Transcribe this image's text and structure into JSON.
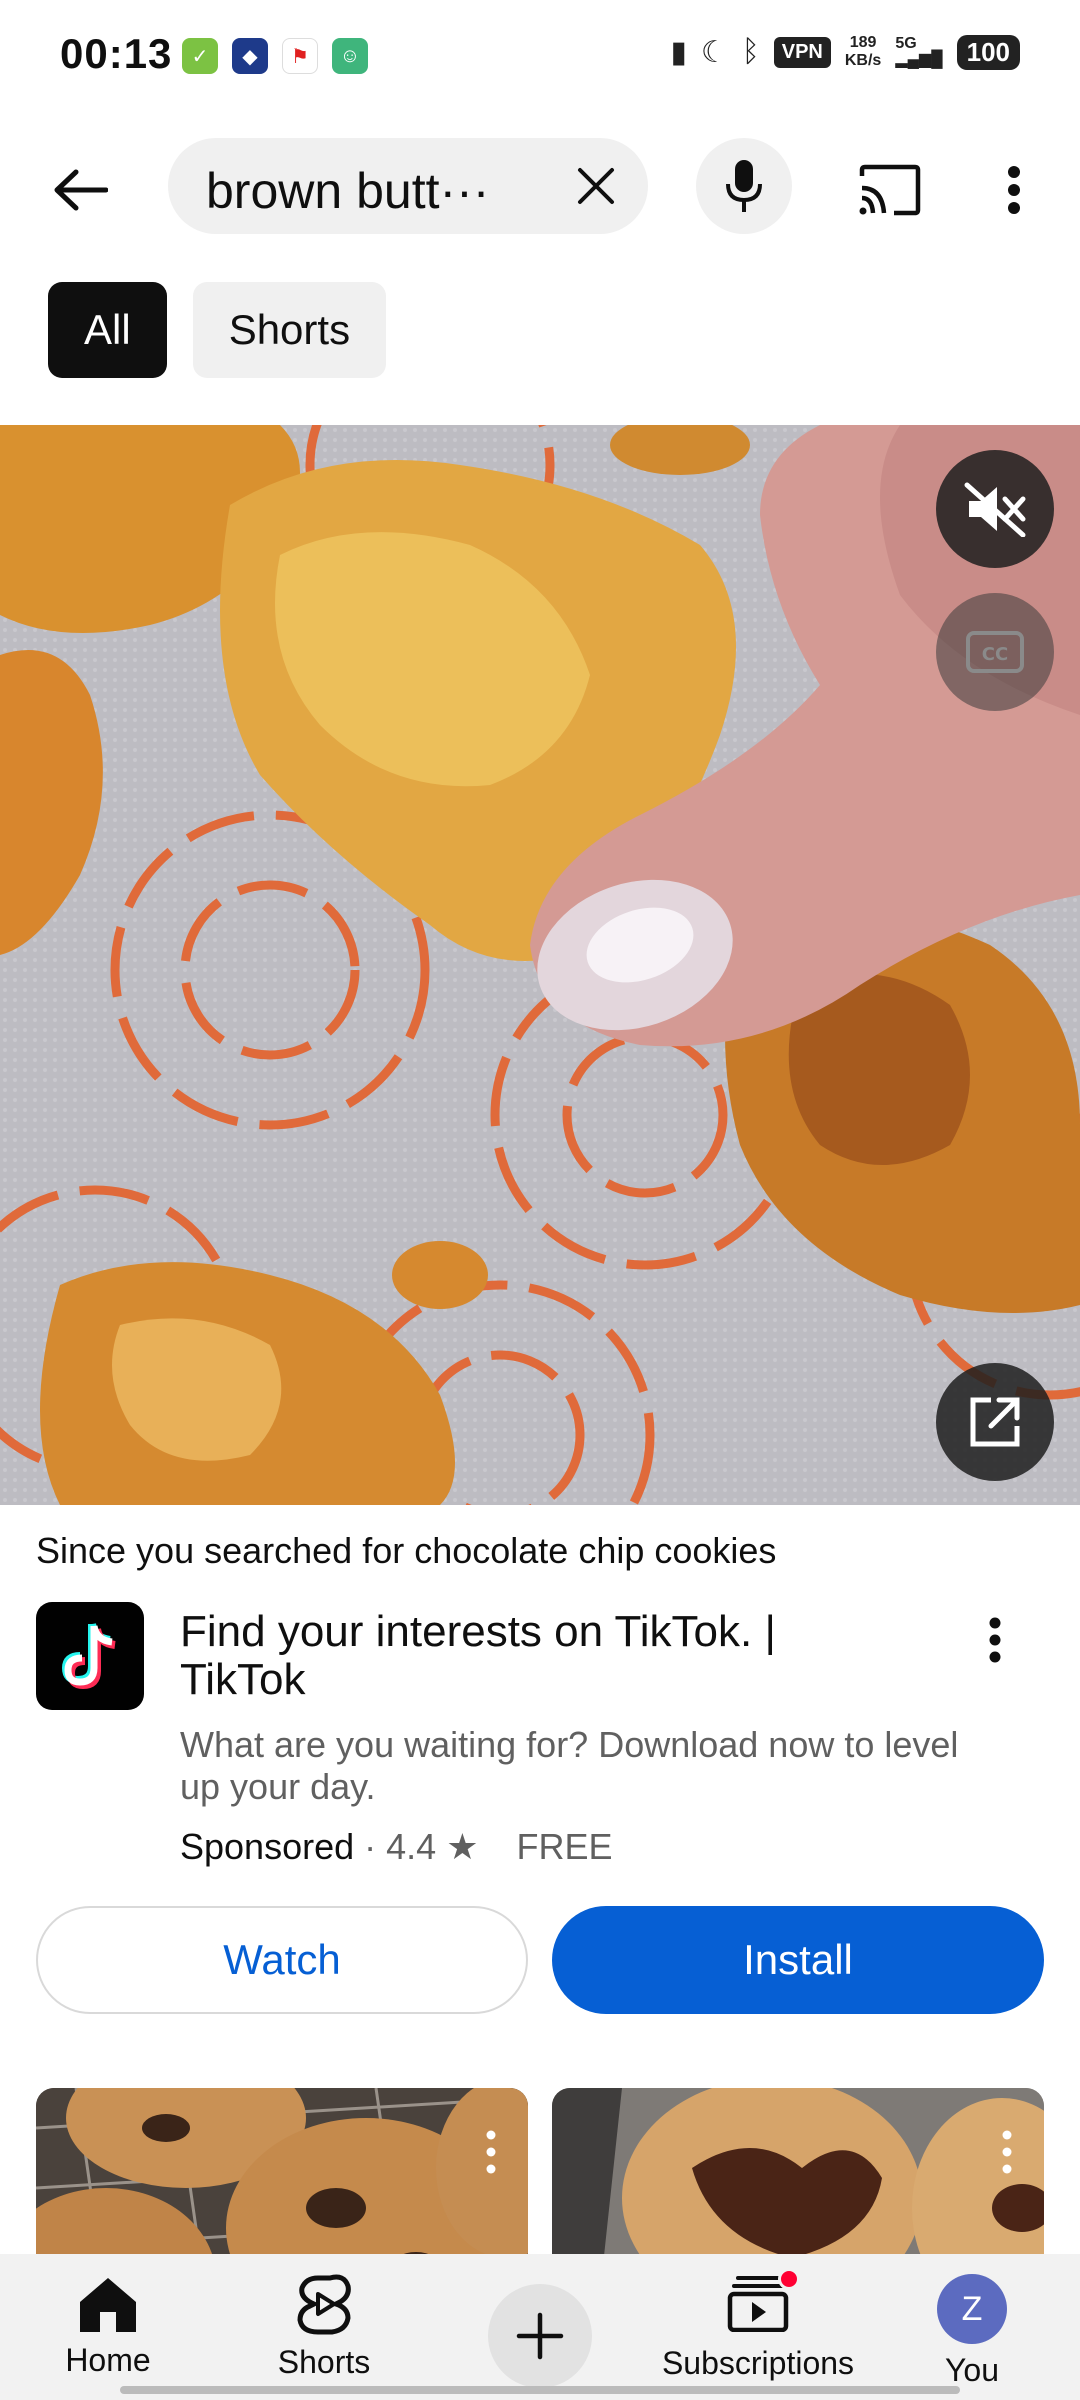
{
  "status_bar": {
    "time": "00:13",
    "vpn": "VPN",
    "speed_value": "189",
    "speed_unit": "KB/s",
    "network": "5G",
    "battery": "100"
  },
  "search": {
    "query": "brown butt···"
  },
  "chips": [
    {
      "label": "All"
    },
    {
      "label": "Shorts"
    }
  ],
  "ad": {
    "since_prefix": "Since you searched for ",
    "since_term": "chocolate chip cookies",
    "title": "Find your interests on TikTok. | TikTok",
    "description": "What are you waiting for? Download now to level up your day.",
    "sponsored": "Sponsored",
    "separator": "·",
    "rating": "4.4",
    "price": "FREE",
    "watch_label": "Watch",
    "install_label": "Install"
  },
  "bottom_nav": {
    "home": "Home",
    "shorts": "Shorts",
    "subscriptions": "Subscriptions",
    "you": "You",
    "avatar_letter": "Z"
  },
  "colors": {
    "accent": "#065fd4",
    "chip_active": "#0f0f0f",
    "chip_inactive": "#f0f0f0",
    "notification_dot": "#ff0033"
  }
}
